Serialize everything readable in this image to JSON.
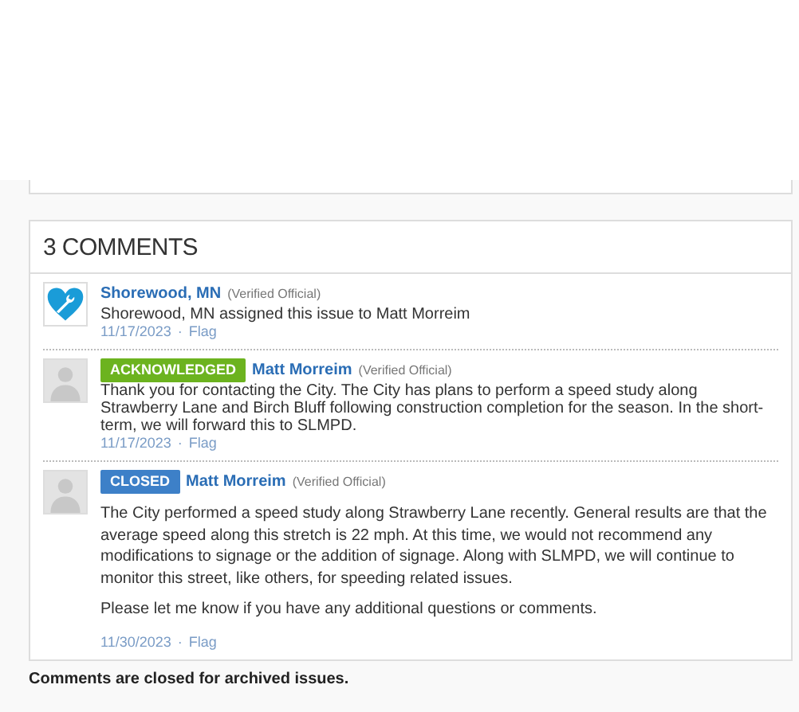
{
  "comments_panel": {
    "title": "3 COMMENTS",
    "comments": [
      {
        "kind": "system",
        "author": "Shorewood, MN",
        "role": "(Verified Official)",
        "paragraphs": [
          "Shorewood, MN assigned this issue to Matt Morreim"
        ],
        "date": "11/17/2023",
        "separator": "·",
        "flag": "Flag"
      },
      {
        "kind": "official",
        "badge": {
          "label": "ACKNOWLEDGED",
          "color": "#6cb31f"
        },
        "author": "Matt Morreim",
        "role": "(Verified Official)",
        "paragraphs": [
          "Thank you for contacting the City. The City has plans to perform a speed study along Strawberry Lane and Birch Bluff following construction completion for the season. In the short-term, we will forward this to SLMPD."
        ],
        "date": "11/17/2023",
        "separator": "·",
        "flag": "Flag"
      },
      {
        "kind": "official",
        "badge": {
          "label": "CLOSED",
          "color": "#3d80c8"
        },
        "author": "Matt Morreim",
        "role": "(Verified Official)",
        "paragraphs": [
          "The City performed a speed study along Strawberry Lane recently. General results are that the average speed along this stretch is 22 mph. At this time, we would not recommend any modifications to signage or the addition of signage. Along with SLMPD, we will continue to monitor this street, like others, for speeding related issues.",
          "Please let me know if you have any additional questions or comments."
        ],
        "date": "11/30/2023",
        "separator": "·",
        "flag": "Flag"
      }
    ]
  },
  "closed_notice": "Comments are closed for archived issues."
}
